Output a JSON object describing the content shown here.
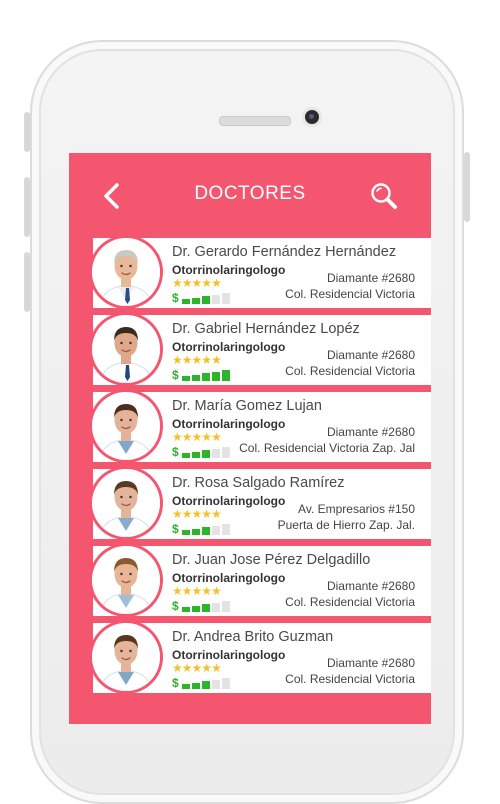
{
  "header": {
    "title": "DOCTORES",
    "back_icon": "chevron-left-icon",
    "search_icon": "search-icon"
  },
  "colors": {
    "accent": "#f5566f",
    "star": "#f2c22d",
    "price_on": "#2db52a",
    "price_off": "#e3e3e3"
  },
  "doctors": [
    {
      "name": "Dr. Gerardo Fernández Hernández",
      "specialty": "Otorrinolaringologo",
      "rating": 4.5,
      "price_level": 3,
      "address_line1": "Diamante #2680",
      "address_line2": "Col. Residencial Victoria"
    },
    {
      "name": "Dr. Gabriel Hernández Lopéz",
      "specialty": "Otorrinolaringologo",
      "rating": 4.5,
      "price_level": 5,
      "address_line1": "Diamante #2680",
      "address_line2": "Col. Residencial Victoria"
    },
    {
      "name": "Dr. María Gomez Lujan",
      "specialty": "Otorrinolaringologo",
      "rating": 4.5,
      "price_level": 3,
      "address_line1": "Diamante #2680",
      "address_line2": "Col. Residencial Victoria Zap. Jal"
    },
    {
      "name": "Dr. Rosa Salgado Ramírez",
      "specialty": "Otorrinolaringologo",
      "rating": 4.5,
      "price_level": 3,
      "address_line1": "Av. Empresarios #150",
      "address_line2": "Puerta de Hierro Zap. Jal."
    },
    {
      "name": "Dr. Juan Jose Pérez Delgadillo",
      "specialty": "Otorrinolaringologo",
      "rating": 4.5,
      "price_level": 3,
      "address_line1": "Diamante #2680",
      "address_line2": "Col. Residencial Victoria"
    },
    {
      "name": "Dr. Andrea Brito Guzman",
      "specialty": "Otorrinolaringologo",
      "rating": 4.5,
      "price_level": 3,
      "address_line1": "Diamante #2680",
      "address_line2": "Col. Residencial Victoria"
    }
  ]
}
